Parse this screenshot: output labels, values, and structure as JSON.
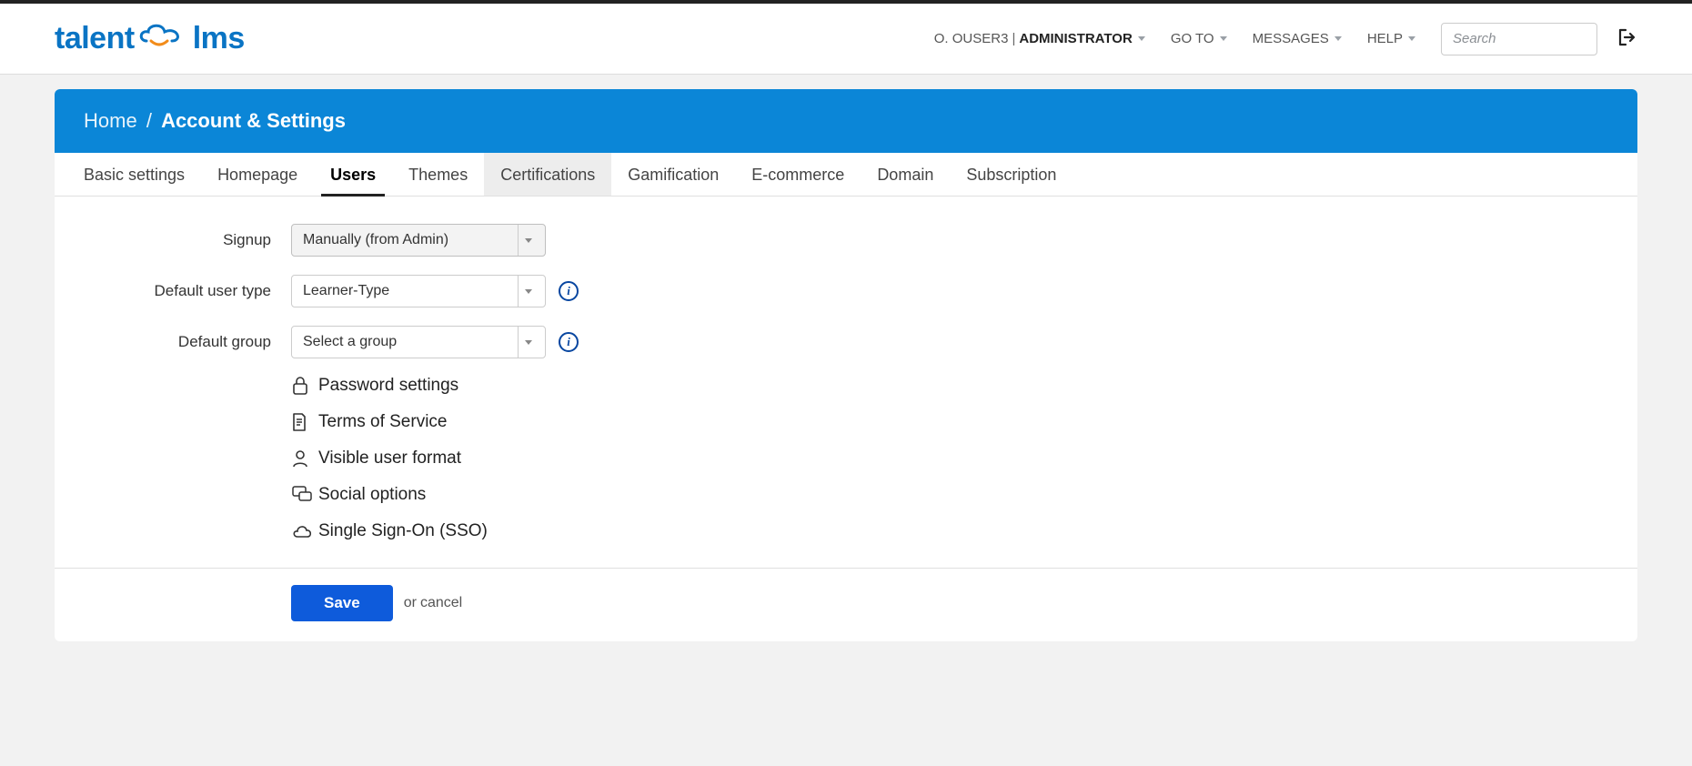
{
  "brand": {
    "talent": "talent",
    "lms": "lms"
  },
  "header": {
    "username": "O. OUSER3",
    "separator": "|",
    "role": "ADMINISTRATOR",
    "goto": "GO TO",
    "messages": "MESSAGES",
    "help": "HELP",
    "search_placeholder": "Search"
  },
  "breadcrumb": {
    "home": "Home",
    "slash": "/",
    "title": "Account & Settings"
  },
  "tabs": [
    {
      "key": "basic",
      "label": "Basic settings"
    },
    {
      "key": "homepage",
      "label": "Homepage"
    },
    {
      "key": "users",
      "label": "Users"
    },
    {
      "key": "themes",
      "label": "Themes"
    },
    {
      "key": "certifications",
      "label": "Certifications"
    },
    {
      "key": "gamification",
      "label": "Gamification"
    },
    {
      "key": "ecommerce",
      "label": "E-commerce"
    },
    {
      "key": "domain",
      "label": "Domain"
    },
    {
      "key": "subscription",
      "label": "Subscription"
    }
  ],
  "form": {
    "signup_label": "Signup",
    "signup_value": "Manually (from Admin)",
    "default_user_type_label": "Default user type",
    "default_user_type_value": "Learner-Type",
    "default_group_label": "Default group",
    "default_group_value": "Select a group"
  },
  "sections": {
    "password": "Password settings",
    "terms": "Terms of Service",
    "visible": "Visible user format",
    "social": "Social options",
    "sso": "Single Sign-On (SSO)"
  },
  "actions": {
    "save": "Save",
    "or": "or",
    "cancel": "cancel"
  },
  "colors": {
    "brand_blue": "#0a74c4",
    "header_blue": "#0b86d7",
    "primary_btn": "#0e5bdb",
    "orange": "#f28c1a"
  }
}
